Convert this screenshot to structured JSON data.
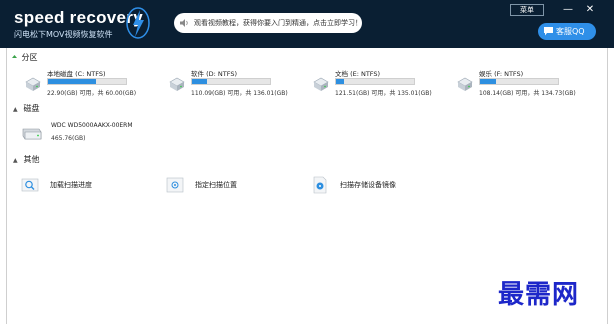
{
  "app": {
    "title": "speed recovery",
    "subtitle": "闪电松下MOV视频恢复软件"
  },
  "header": {
    "notice": "观看视频教程，获得你要入门到精通，点击立即学习！",
    "menu_label": "菜单",
    "minimize_glyph": "—",
    "close_glyph": "✕",
    "service_label": "客服QQ"
  },
  "sections": {
    "partitions_label": "分区",
    "disks_label": "磁盘",
    "other_label": "其他"
  },
  "partitions": [
    {
      "label": "本地磁盘 (C: NTFS)",
      "capacity": "22.90(GB) 可用，共 60.00(GB)",
      "used_fraction": 0.62
    },
    {
      "label": "软件 (D: NTFS)",
      "capacity": "110.09(GB) 可用，共 136.01(GB)",
      "used_fraction": 0.19
    },
    {
      "label": "文档 (E: NTFS)",
      "capacity": "121.51(GB) 可用，共 135.01(GB)",
      "used_fraction": 0.1
    },
    {
      "label": "娱乐 (F: NTFS)",
      "capacity": "108.14(GB) 可用，共 134.73(GB)",
      "used_fraction": 0.2
    }
  ],
  "disk": {
    "name": "WDC WD5000AAKX-00ERM",
    "size": "465.76(GB)"
  },
  "tools": [
    {
      "label": "加载扫描进度"
    },
    {
      "label": "指定扫描位置"
    },
    {
      "label": "扫描存储设备镜像"
    }
  ],
  "watermark": "最需网",
  "colors": {
    "header_bg": "#0a1f33",
    "accent": "#2d8fe0",
    "service_btn": "#2f8fe8",
    "watermark": "#1d27c9"
  }
}
